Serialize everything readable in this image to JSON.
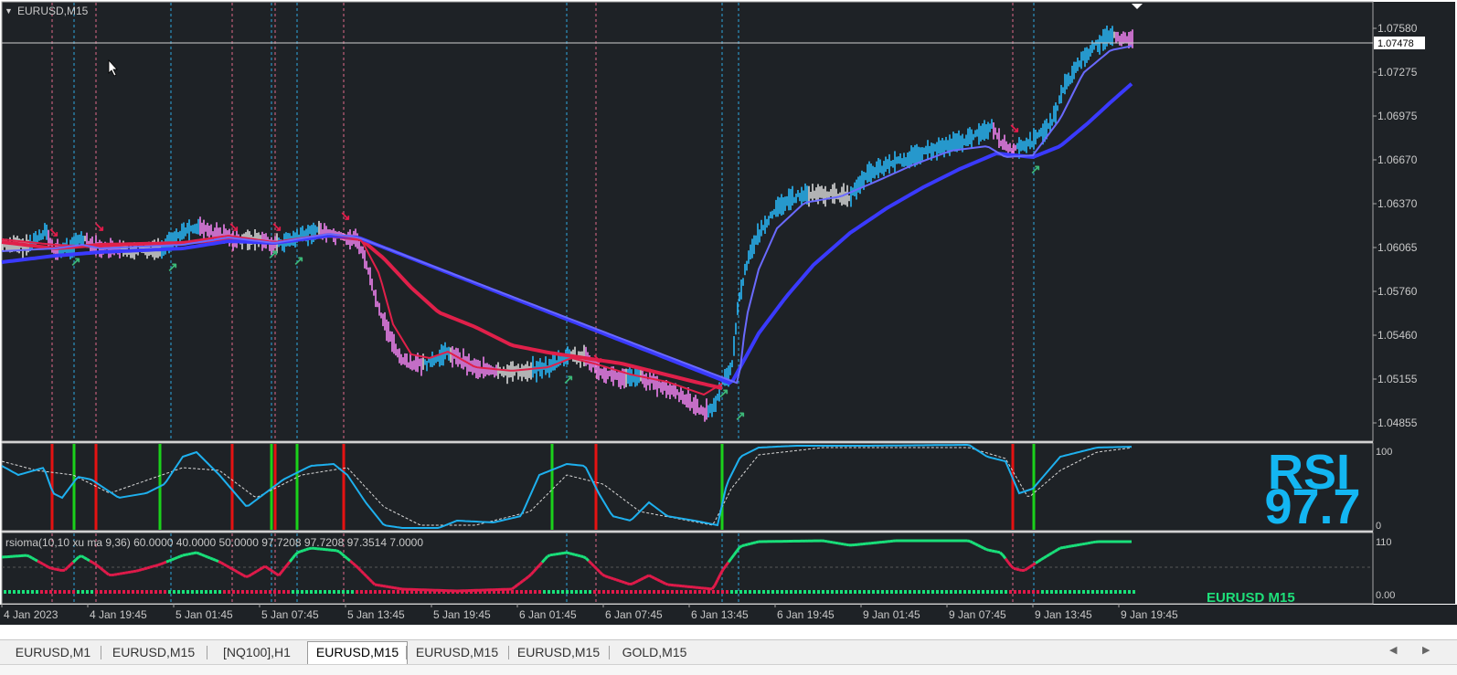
{
  "chart": {
    "symbol_label": "EURUSD,M15",
    "price_scale": [
      "1.07580",
      "1.07275",
      "1.06975",
      "1.06670",
      "1.06370",
      "1.06065",
      "1.05760",
      "1.05460",
      "1.05155",
      "1.04855"
    ],
    "current_price": "1.07478",
    "time_labels": [
      "4 Jan 2023",
      "4 Jan 19:45",
      "5 Jan 01:45",
      "5 Jan 07:45",
      "5 Jan 13:45",
      "5 Jan 19:45",
      "6 Jan 01:45",
      "6 Jan 07:45",
      "6 Jan 13:45",
      "6 Jan 19:45",
      "9 Jan 01:45",
      "9 Jan 07:45",
      "9 Jan 13:45",
      "9 Jan 19:45"
    ]
  },
  "rsi_panel": {
    "scale_top": "100",
    "scale_bottom": "0",
    "big_title": "RSI",
    "big_value": "97.7"
  },
  "rsioma_panel": {
    "legend": "rsioma(10,10 xu ma 9,36) 60.0000 40.0000 50.0000 97.7208 97.7208 97.3514 7.0000",
    "scale_top": "110",
    "scale_bottom": "0.00",
    "watermark": "EURUSD M15"
  },
  "tabs": [
    {
      "label": "EURUSD,M1",
      "active": false
    },
    {
      "label": "EURUSD,M15",
      "active": false
    },
    {
      "label": "[NQ100],H1",
      "active": false
    },
    {
      "label": "EURUSD,M15",
      "active": true
    },
    {
      "label": "EURUSD,M15",
      "active": false
    },
    {
      "label": "EURUSD,M15",
      "active": false
    },
    {
      "label": "GOLD,M15",
      "active": false
    }
  ],
  "colors": {
    "background": "#1e2226",
    "grid_border": "#a6a6a6",
    "bull_candle": "#29b6f6",
    "bear_candle": "#ee82ee",
    "neutral_candle": "#d8d8d8",
    "ma_red": "#e0204a",
    "ma_blue": "#3a3aff",
    "rsi_line": "#1eb0ee",
    "signal_green": "#1bd11b",
    "signal_red": "#e51212",
    "rsioma_green": "#19e07a",
    "rsioma_red": "#e01a4a",
    "watermark": "#1ee07a",
    "big_text": "#13b6f2"
  }
}
